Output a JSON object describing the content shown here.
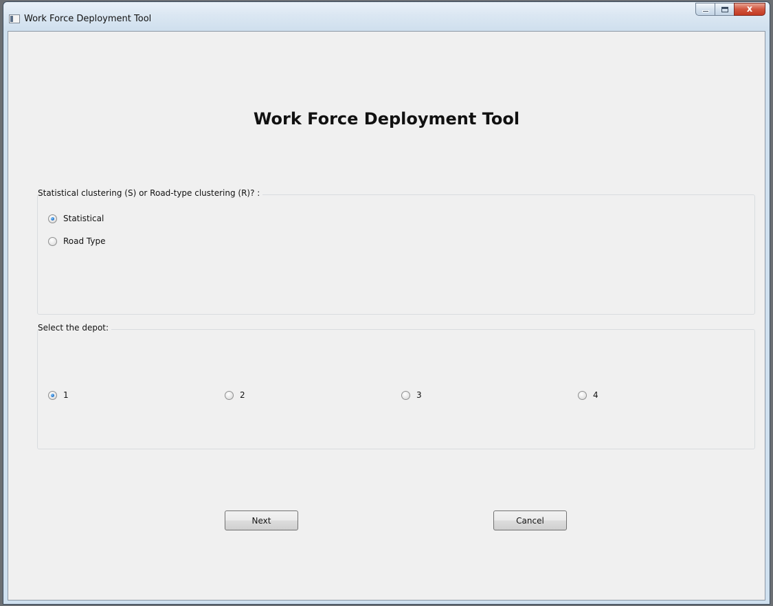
{
  "window": {
    "title": "Work Force Deployment Tool",
    "controls": {
      "minimize_icon": "minimize-icon",
      "maximize_icon": "maximize-icon",
      "close_label": "x"
    }
  },
  "main": {
    "heading": "Work Force Deployment Tool",
    "clustering_group": {
      "label": "Statistical clustering (S) or Road-type clustering (R)? :",
      "options": [
        {
          "label": "Statistical",
          "checked": true
        },
        {
          "label": "Road Type",
          "checked": false
        }
      ]
    },
    "depot_group": {
      "label": "Select the depot:",
      "options": [
        {
          "label": "1",
          "checked": true
        },
        {
          "label": "2",
          "checked": false
        },
        {
          "label": "3",
          "checked": false
        },
        {
          "label": "4",
          "checked": false
        }
      ]
    },
    "buttons": {
      "next_label": "Next",
      "cancel_label": "Cancel"
    }
  }
}
